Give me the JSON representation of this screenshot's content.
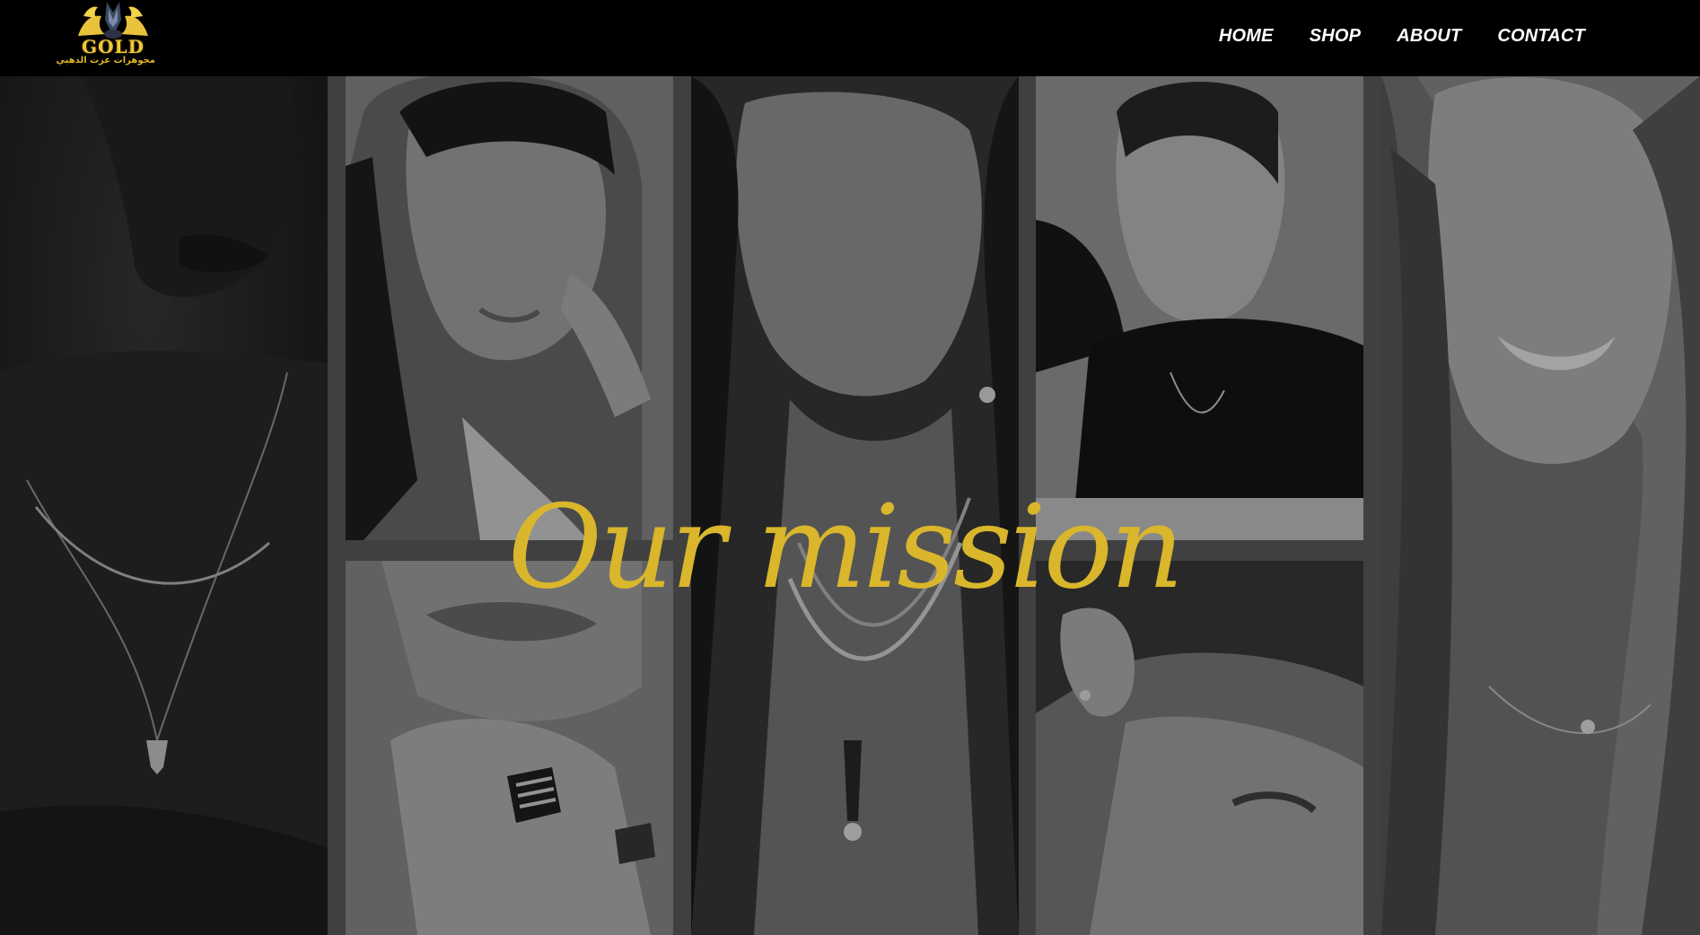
{
  "header": {
    "logo_text": "GOLD",
    "logo_subtext": "مجوهرات عزت الدهبي",
    "nav": [
      {
        "label": "HOME"
      },
      {
        "label": "SHOP"
      },
      {
        "label": "ABOUT"
      },
      {
        "label": "CONTACT"
      }
    ]
  },
  "hero": {
    "title": "Our mission",
    "title_color": "#d9b62c"
  },
  "colors": {
    "header_bg": "#000000",
    "nav_text": "#ffffff",
    "accent_gold": "#d9b62c"
  }
}
